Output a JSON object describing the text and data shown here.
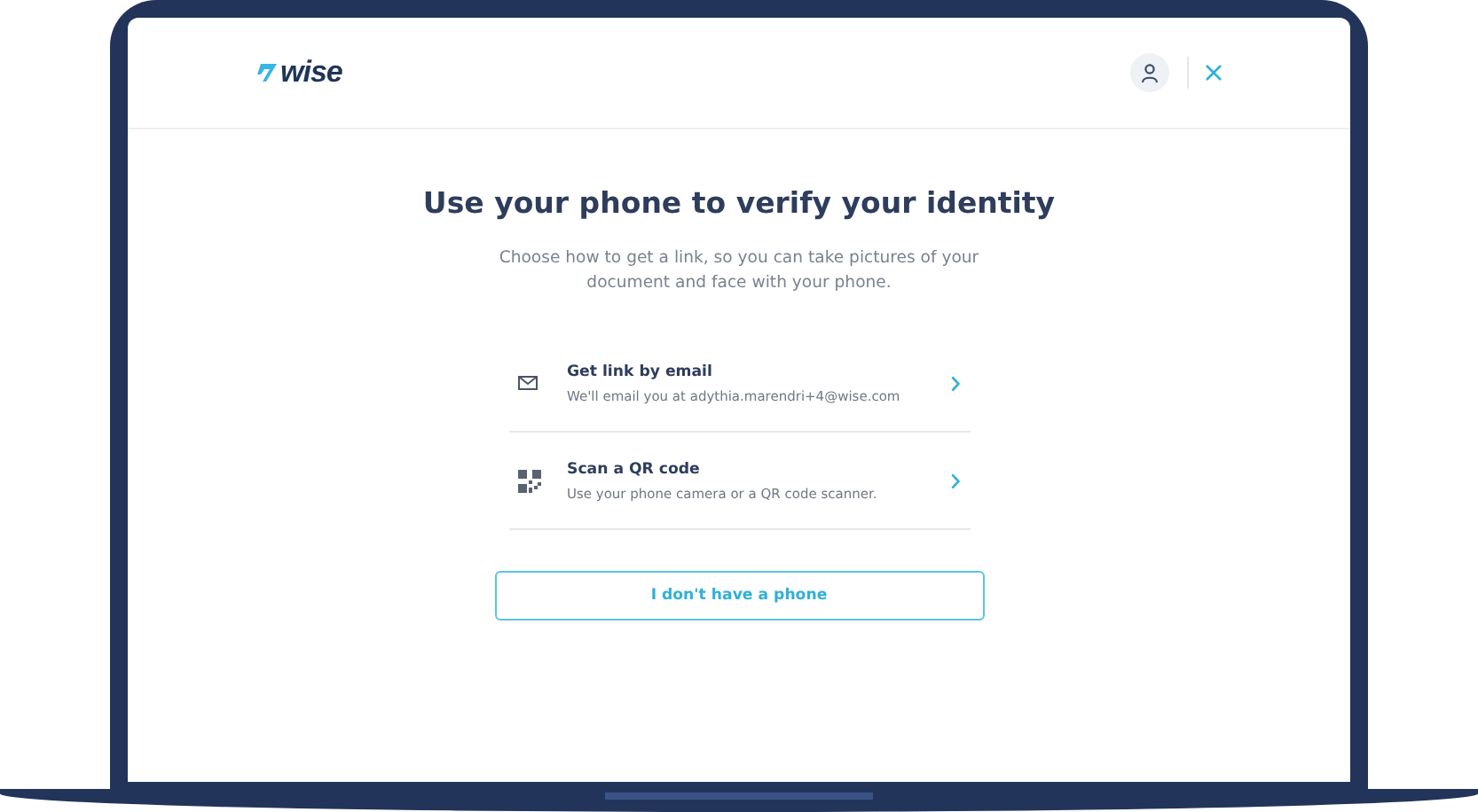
{
  "header": {
    "logo": "wise"
  },
  "title": "Use your phone to verify your identity",
  "subtitle": "Choose how to get a link, so you can take pictures of your document and face with your phone.",
  "options": [
    {
      "kind": "email",
      "title": "Get link by email",
      "description": "We'll email you at adythia.marendri+4@wise.com"
    },
    {
      "kind": "qr",
      "title": "Scan a QR code",
      "description": "Use your phone camera or a QR code scanner."
    }
  ],
  "button": "I don't have a phone"
}
